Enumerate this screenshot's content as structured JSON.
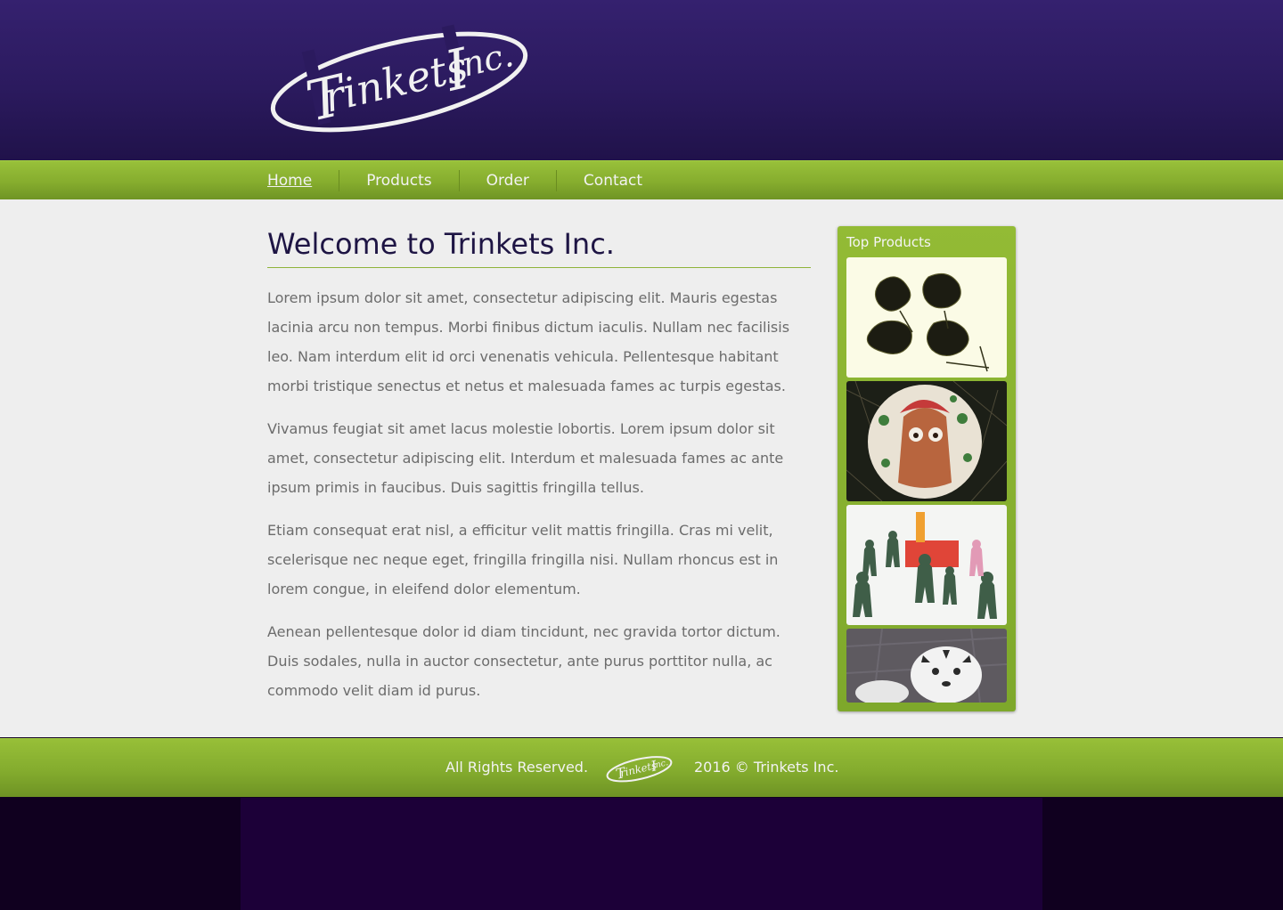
{
  "logo": {
    "text": "Trinkets Inc."
  },
  "nav": {
    "items": [
      {
        "label": "Home",
        "active": true
      },
      {
        "label": "Products",
        "active": false
      },
      {
        "label": "Order",
        "active": false
      },
      {
        "label": "Contact",
        "active": false
      }
    ]
  },
  "main": {
    "title": "Welcome to Trinkets Inc.",
    "paragraphs": [
      "Lorem ipsum dolor sit amet, consectetur adipiscing elit. Mauris egestas lacinia arcu non tempus. Morbi finibus dictum iaculis. Nullam nec facilisis leo. Nam interdum elit id orci venenatis vehicula. Pellentesque habitant morbi tristique senectus et netus et malesuada fames ac turpis egestas.",
      "Vivamus feugiat sit amet lacus molestie lobortis. Lorem ipsum dolor sit amet, consectetur adipiscing elit. Interdum et malesuada fames ac ante ipsum primis in faucibus. Duis sagittis fringilla tellus.",
      "Etiam consequat erat nisl, a efficitur velit mattis fringilla. Cras mi velit, scelerisque nec neque eget, fringilla fringilla nisi. Nullam rhoncus est in lorem congue, in eleifend dolor elementum.",
      "Aenean pellentesque dolor id diam tincidunt, nec gravida tortor dictum. Duis sodales, nulla in auctor consectetur, ante purus porttitor nulla, ac commodo velit diam id purus."
    ]
  },
  "sidebar": {
    "title": "Top Products",
    "products": [
      {
        "image": "dark-dried-flowers"
      },
      {
        "image": "painted-ornament-ball"
      },
      {
        "image": "green-toy-soldiers"
      },
      {
        "image": "white-tiger-plush"
      }
    ]
  },
  "footer": {
    "rights": "All Rights Reserved.",
    "copyright": "2016 © Trinkets Inc."
  },
  "colors": {
    "header_purple": "#2b1a5e",
    "nav_green": "#86ad2e",
    "content_bg": "#eeeeee",
    "title_color": "#1e1544",
    "text_gray": "#6c6c6c",
    "page_bg": "#10001f"
  }
}
